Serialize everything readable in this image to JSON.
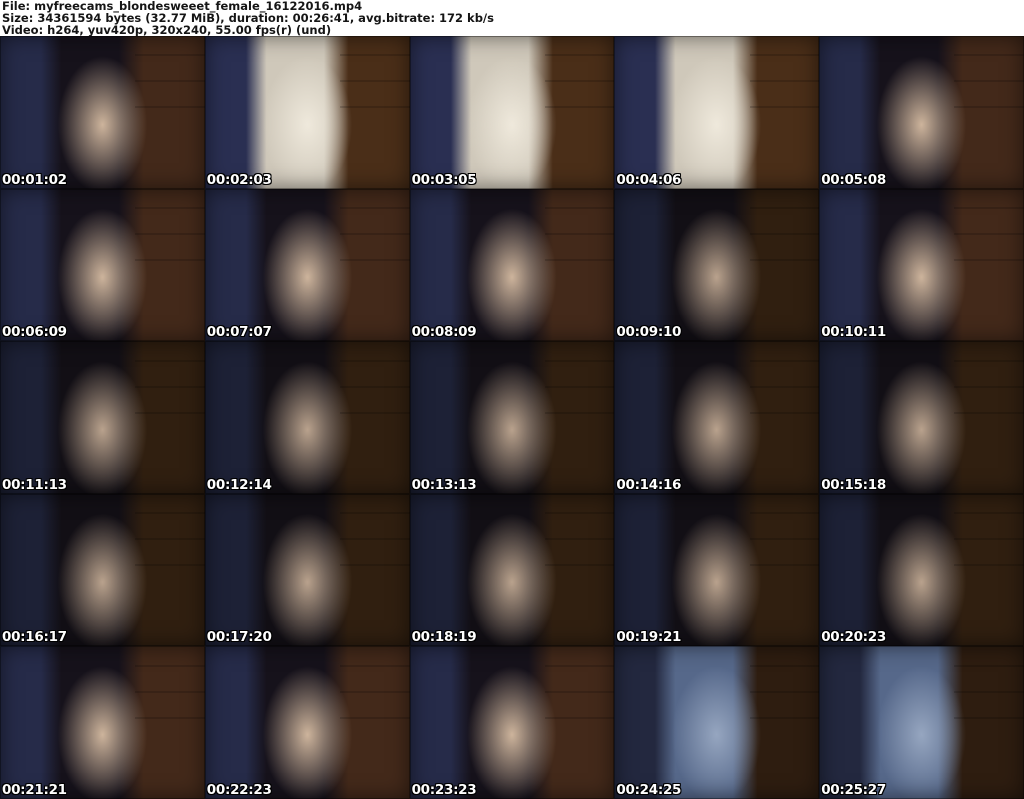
{
  "header": {
    "lines": [
      "File: myfreecams_blondesweeet_female_16122016.mp4",
      "Size: 34361594 bytes (32.77 MiB), duration: 00:26:41, avg.bitrate: 172 kb/s",
      "Video: h264, yuv420p, 320x240, 55.00 fps(r) (und)"
    ]
  },
  "colors": {
    "header_bg": "#ffffff",
    "header_text": "#151515",
    "timestamp_text": "#ffffff",
    "timestamp_outline": "#000000"
  },
  "palettes": {
    "A": {
      "left": "#262b49",
      "mid": "#16121b",
      "right": "#43291a",
      "glow": "#cdb49c"
    },
    "B": {
      "left": "#2a2f52",
      "mid": "#cfc8ba",
      "right": "#4a2e18",
      "glow": "#efe9dc"
    },
    "C": {
      "left": "#1d2136",
      "mid": "#120f15",
      "right": "#301f10",
      "glow": "#b9a28d"
    },
    "D": {
      "left": "#23283f",
      "mid": "#56688a",
      "right": "#2e1d10",
      "glow": "#96a6c0"
    }
  },
  "thumbnails": [
    {
      "timestamp": "00:01:02",
      "palette": "A"
    },
    {
      "timestamp": "00:02:03",
      "palette": "B"
    },
    {
      "timestamp": "00:03:05",
      "palette": "B"
    },
    {
      "timestamp": "00:04:06",
      "palette": "B"
    },
    {
      "timestamp": "00:05:08",
      "palette": "A"
    },
    {
      "timestamp": "00:06:09",
      "palette": "A"
    },
    {
      "timestamp": "00:07:07",
      "palette": "A"
    },
    {
      "timestamp": "00:08:09",
      "palette": "A"
    },
    {
      "timestamp": "00:09:10",
      "palette": "C"
    },
    {
      "timestamp": "00:10:11",
      "palette": "A"
    },
    {
      "timestamp": "00:11:13",
      "palette": "C"
    },
    {
      "timestamp": "00:12:14",
      "palette": "C"
    },
    {
      "timestamp": "00:13:13",
      "palette": "C"
    },
    {
      "timestamp": "00:14:16",
      "palette": "C"
    },
    {
      "timestamp": "00:15:18",
      "palette": "C"
    },
    {
      "timestamp": "00:16:17",
      "palette": "C"
    },
    {
      "timestamp": "00:17:20",
      "palette": "C"
    },
    {
      "timestamp": "00:18:19",
      "palette": "C"
    },
    {
      "timestamp": "00:19:21",
      "palette": "C"
    },
    {
      "timestamp": "00:20:23",
      "palette": "C"
    },
    {
      "timestamp": "00:21:21",
      "palette": "A"
    },
    {
      "timestamp": "00:22:23",
      "palette": "A"
    },
    {
      "timestamp": "00:23:23",
      "palette": "A"
    },
    {
      "timestamp": "00:24:25",
      "palette": "D"
    },
    {
      "timestamp": "00:25:27",
      "palette": "D"
    }
  ]
}
